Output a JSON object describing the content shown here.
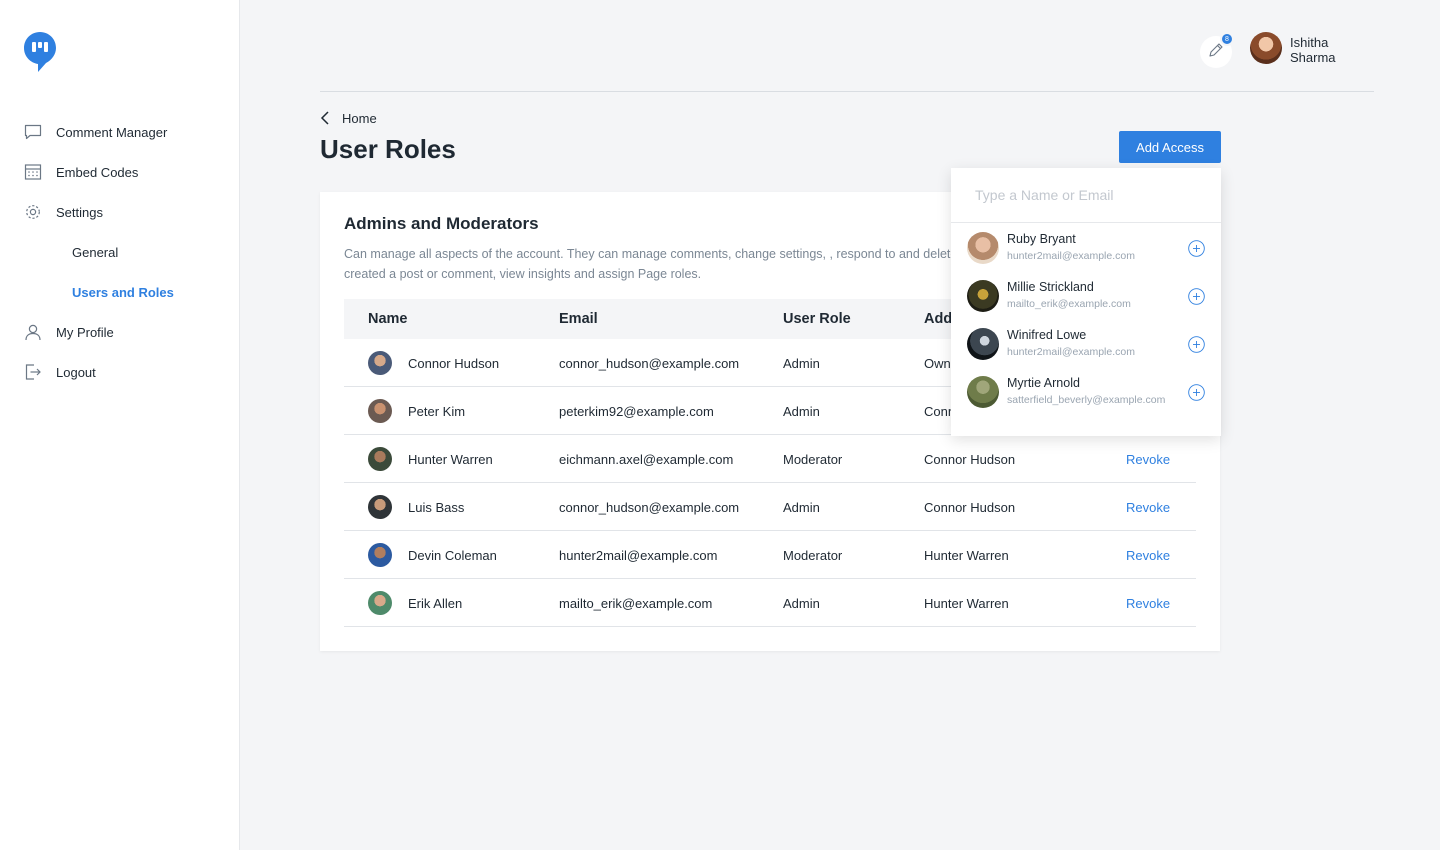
{
  "sidebar": {
    "items": [
      {
        "label": "Comment Manager",
        "icon": "chat-bubble-icon"
      },
      {
        "label": "Embed Codes",
        "icon": "calendar-grid-icon"
      },
      {
        "label": "Settings",
        "icon": "gear-icon"
      },
      {
        "label": "General"
      },
      {
        "label": "Users and Roles",
        "active": true
      },
      {
        "label": "My Profile",
        "icon": "user-icon"
      },
      {
        "label": "Logout",
        "icon": "logout-icon"
      }
    ]
  },
  "header": {
    "notification_count": "8",
    "user_name": "Ishitha Sharma"
  },
  "breadcrumb": {
    "label": "Home"
  },
  "page": {
    "title": "User Roles",
    "add_access_label": "Add Access"
  },
  "card": {
    "title": "Admins and Moderators",
    "description": "Can manage all aspects of the account. They can manage comments, change settings, , respond to and delete comments on the Page, see which admin created a post or comment, view insights and assign Page roles."
  },
  "table": {
    "headers": [
      "Name",
      "Email",
      "User Role",
      "Added By"
    ],
    "rows": [
      {
        "name": "Connor Hudson",
        "email": "connor_hudson@example.com",
        "role": "Admin",
        "added_by": "Owner",
        "action": ""
      },
      {
        "name": "Peter Kim",
        "email": "peterkim92@example.com",
        "role": "Admin",
        "added_by": "Connor Hudson",
        "action": ""
      },
      {
        "name": "Hunter Warren",
        "email": "eichmann.axel@example.com",
        "role": "Moderator",
        "added_by": "Connor Hudson",
        "action": "Revoke"
      },
      {
        "name": "Luis Bass",
        "email": "connor_hudson@example.com",
        "role": "Admin",
        "added_by": "Connor Hudson",
        "action": "Revoke"
      },
      {
        "name": "Devin Coleman",
        "email": "hunter2mail@example.com",
        "role": "Moderator",
        "added_by": "Hunter Warren",
        "action": "Revoke"
      },
      {
        "name": "Erik Allen",
        "email": "mailto_erik@example.com",
        "role": "Admin",
        "added_by": "Hunter Warren",
        "action": "Revoke"
      }
    ]
  },
  "dropdown": {
    "placeholder": "Type a Name or Email",
    "items": [
      {
        "name": "Ruby Bryant",
        "email": "hunter2mail@example.com"
      },
      {
        "name": "Millie Strickland",
        "email": "mailto_erik@example.com"
      },
      {
        "name": "Winifred Lowe",
        "email": "hunter2mail@example.com"
      },
      {
        "name": "Myrtie Arnold",
        "email": "satterfield_beverly@example.com"
      }
    ]
  },
  "colors": {
    "accent": "#2f80e0",
    "background": "#f4f5f7",
    "text": "#1f2933",
    "muted": "#7b8794"
  }
}
